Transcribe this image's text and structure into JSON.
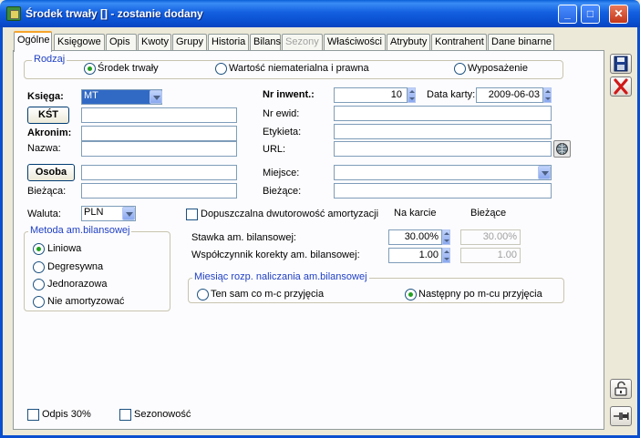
{
  "window": {
    "title": "Środek trwały [] - zostanie dodany"
  },
  "tabs": [
    "Ogólne",
    "Księgowe",
    "Opis",
    "Kwoty",
    "Grupy",
    "Historia",
    "Bilans",
    "Sezony",
    "Właściwości",
    "Atrybuty",
    "Kontrahent",
    "Dane binarne"
  ],
  "rodzaj": {
    "legend": "Rodzaj",
    "options": [
      "Środek trwały",
      "Wartość niematerialna i prawna",
      "Wyposażenie"
    ],
    "selected": "Środek trwały"
  },
  "left": {
    "ksiega_label": "Księga:",
    "ksiega_value": "MT",
    "kst_button": "KŚT",
    "akronim_label": "Akronim:",
    "nazwa_label": "Nazwa:",
    "osoba_button": "Osoba",
    "biezaca_label": "Bieżąca:",
    "waluta_label": "Waluta:",
    "waluta_value": "PLN"
  },
  "right": {
    "nr_inwent_label": "Nr inwent.:",
    "nr_inwent_value": "10",
    "data_karty_label": "Data karty:",
    "data_karty_value": "2009-06-03",
    "nr_ewid_label": "Nr ewid:",
    "etykieta_label": "Etykieta:",
    "url_label": "URL:",
    "miejsce_label": "Miejsce:",
    "biezace_label": "Bieżące:"
  },
  "metoda": {
    "legend": "Metoda am.bilansowej",
    "options": [
      "Liniowa",
      "Degresywna",
      "Jednorazowa",
      "Nie amortyzować"
    ],
    "selected": "Liniowa"
  },
  "amort": {
    "dwutorowosc_label": "Dopuszczalna dwutorowość amortyzacji",
    "col_karta": "Na karcie",
    "col_biezace": "Bieżące",
    "stawka_label": "Stawka am. bilansowej:",
    "stawka_karta": "30.00%",
    "stawka_biezace": "30.00%",
    "wspolczynnik_label": "Współczynnik korekty am. bilansowej:",
    "wsp_karta": "1.00",
    "wsp_biezace": "1.00"
  },
  "miesiac": {
    "legend": "Miesiąc rozp. naliczania am.bilansowej",
    "options": [
      "Ten sam co m-c przyjęcia",
      "Następny po m-cu przyjęcia"
    ],
    "selected": "Następny po m-cu przyjęcia"
  },
  "bottom": {
    "odpis_label": "Odpis 30%",
    "sezonowosc_label": "Sezonowość"
  }
}
